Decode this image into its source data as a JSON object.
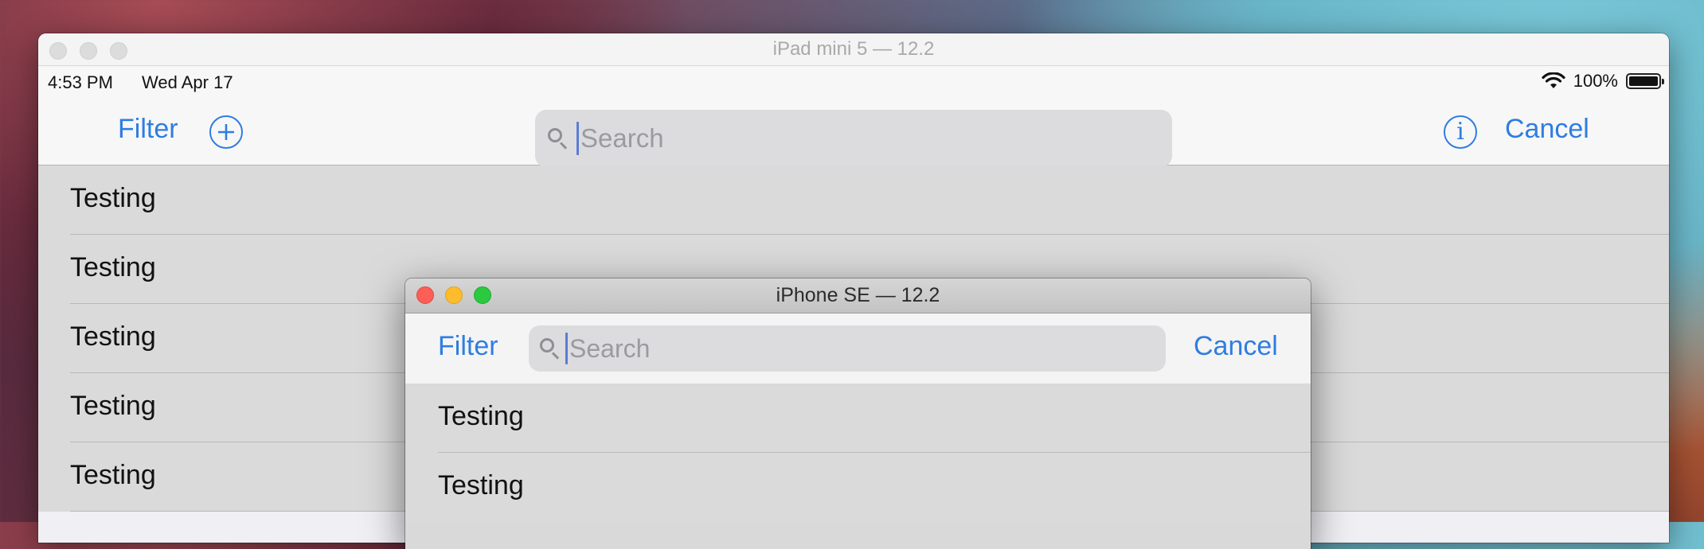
{
  "ipad": {
    "window_title": "iPad mini 5 — 12.2",
    "status": {
      "time": "4:53 PM",
      "date": "Wed Apr 17",
      "battery": "100%",
      "wifi_icon": "wifi-icon",
      "battery_icon": "battery-icon"
    },
    "nav": {
      "filter_label": "Filter",
      "add_icon": "plus-circle-icon",
      "search_placeholder": "Search",
      "info_icon": "info-circle-icon",
      "cancel_label": "Cancel"
    },
    "rows": [
      "Testing",
      "Testing",
      "Testing",
      "Testing",
      "Testing"
    ]
  },
  "iphone": {
    "window_title": "iPhone SE — 12.2",
    "nav": {
      "filter_label": "Filter",
      "search_placeholder": "Search",
      "cancel_label": "Cancel"
    },
    "rows": [
      "Testing",
      "Testing"
    ]
  },
  "colors": {
    "accent": "#2f7de1",
    "list_bg": "#dadada"
  }
}
